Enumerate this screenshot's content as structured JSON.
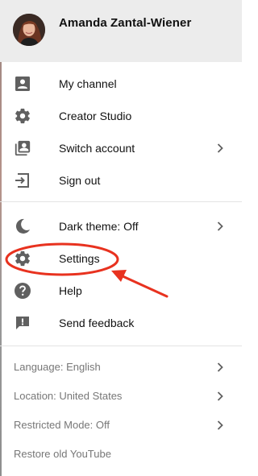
{
  "account": {
    "name": "Amanda Zantal-Wiener",
    "avatar_icon": "user-avatar-photo"
  },
  "menu": {
    "group1": [
      {
        "label": "My channel",
        "icon": "person-badge-icon"
      },
      {
        "label": "Creator Studio",
        "icon": "gear-icon"
      },
      {
        "label": "Switch account",
        "icon": "switch-account-icon",
        "has_chevron": true
      },
      {
        "label": "Sign out",
        "icon": "sign-out-icon"
      }
    ],
    "group2": [
      {
        "label": "Dark theme: Off",
        "icon": "moon-icon",
        "has_chevron": true
      },
      {
        "label": "Settings",
        "icon": "gear-icon"
      },
      {
        "label": "Help",
        "icon": "help-icon"
      },
      {
        "label": "Send feedback",
        "icon": "feedback-icon"
      }
    ],
    "group3": [
      {
        "label": "Language: English",
        "has_chevron": true
      },
      {
        "label": "Location: United States",
        "has_chevron": true
      },
      {
        "label": "Restricted Mode: Off",
        "has_chevron": true
      },
      {
        "label": "Restore old YouTube"
      }
    ]
  },
  "colors": {
    "header_bg": "#ececec",
    "icon": "#606060",
    "annotation": "#e8321f"
  }
}
